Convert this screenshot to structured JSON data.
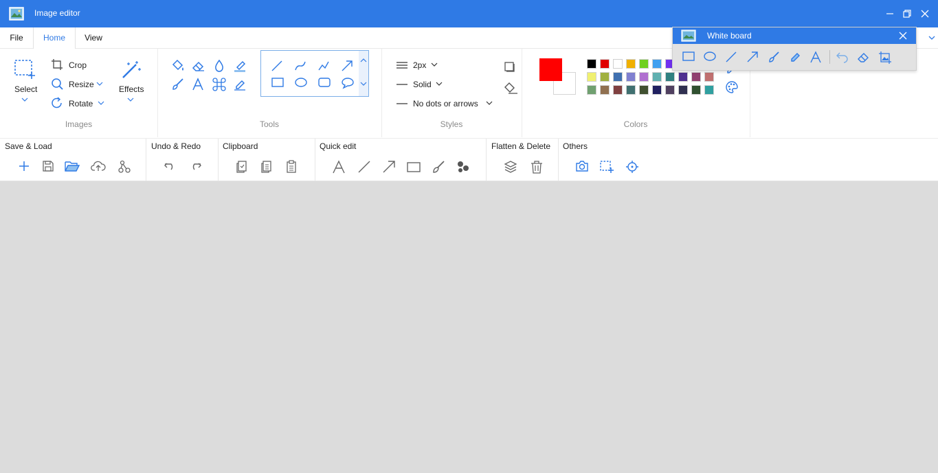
{
  "window": {
    "title": "Image editor",
    "icon": "image-editor-icon",
    "controls": [
      "minimize-icon",
      "maximize-icon",
      "close-icon"
    ]
  },
  "menu": {
    "tabs": [
      {
        "label": "File",
        "active": false
      },
      {
        "label": "Home",
        "active": true
      },
      {
        "label": "View",
        "active": false
      }
    ]
  },
  "ribbon": {
    "images": {
      "label": "Images",
      "select_label": "Select",
      "crop_label": "Crop",
      "resize_label": "Resize",
      "rotate_label": "Rotate",
      "effects_label": "Effects"
    },
    "tools": {
      "label": "Tools",
      "icons": [
        "fill-bucket-icon",
        "eraser-icon",
        "color-picker-drop-icon",
        "highlighter-icon",
        "brush-icon",
        "text-icon",
        "command-icon",
        "marker-icon"
      ],
      "shapes": [
        "line-icon",
        "curve-icon",
        "polyline-icon",
        "arrow-icon",
        "rectangle-icon",
        "ellipse-icon",
        "rounded-rectangle-icon",
        "speech-bubble-icon"
      ]
    },
    "styles": {
      "label": "Styles",
      "width_value": "2px",
      "line_value": "Solid",
      "ends_value": "No dots or arrows"
    },
    "colors": {
      "label": "Colors",
      "primary": "#ff0000",
      "secondary": "#ffffff",
      "palette_rows": [
        [
          "#000000",
          "#e00000",
          "#ffffff",
          "#f0b000",
          "#70d020",
          "#40a0f0",
          "#7030f0"
        ],
        [
          "#f0f070",
          "#a0b040",
          "#4070b0",
          "#8080d0",
          "#b070d0",
          "#60b0b0",
          "#308080",
          "#503090",
          "#904070",
          "#c07070"
        ],
        [
          "#70a070",
          "#907050",
          "#804040",
          "#407070",
          "#405030",
          "#202060",
          "#504060",
          "#303050",
          "#305030",
          "#30a0a0"
        ]
      ]
    }
  },
  "quick": {
    "groups": [
      {
        "label": "Save & Load",
        "icons": [
          "new-icon",
          "save-icon",
          "open-folder-icon",
          "cloud-upload-icon",
          "share-icon"
        ]
      },
      {
        "label": "Undo & Redo",
        "icons": [
          "undo-icon",
          "redo-icon"
        ]
      },
      {
        "label": "Clipboard",
        "icons": [
          "copy-icon",
          "copy-all-icon",
          "paste-icon"
        ]
      },
      {
        "label": "Quick edit",
        "icons": [
          "text-icon",
          "line-icon",
          "arrow-icon",
          "rectangle-icon",
          "brush-icon",
          "numbering-icon"
        ]
      },
      {
        "label": "Flatten & Delete",
        "icons": [
          "layers-icon",
          "delete-icon"
        ]
      },
      {
        "label": "Others",
        "icons": [
          "camera-icon",
          "add-selection-icon",
          "target-icon"
        ]
      }
    ]
  },
  "whiteboard": {
    "title": "White board",
    "tools": [
      "rectangle-icon",
      "ellipse-icon",
      "line-icon",
      "arrow-icon",
      "brush-icon",
      "highlighter-icon",
      "text-icon",
      "undo-icon",
      "eraser-icon",
      "image-crop-icon"
    ]
  },
  "colors": {
    "accent": "#2f7ae5",
    "icon_blue": "#2f7ae5",
    "icon_gray": "#666666",
    "canvas": "#dcdcdc"
  }
}
